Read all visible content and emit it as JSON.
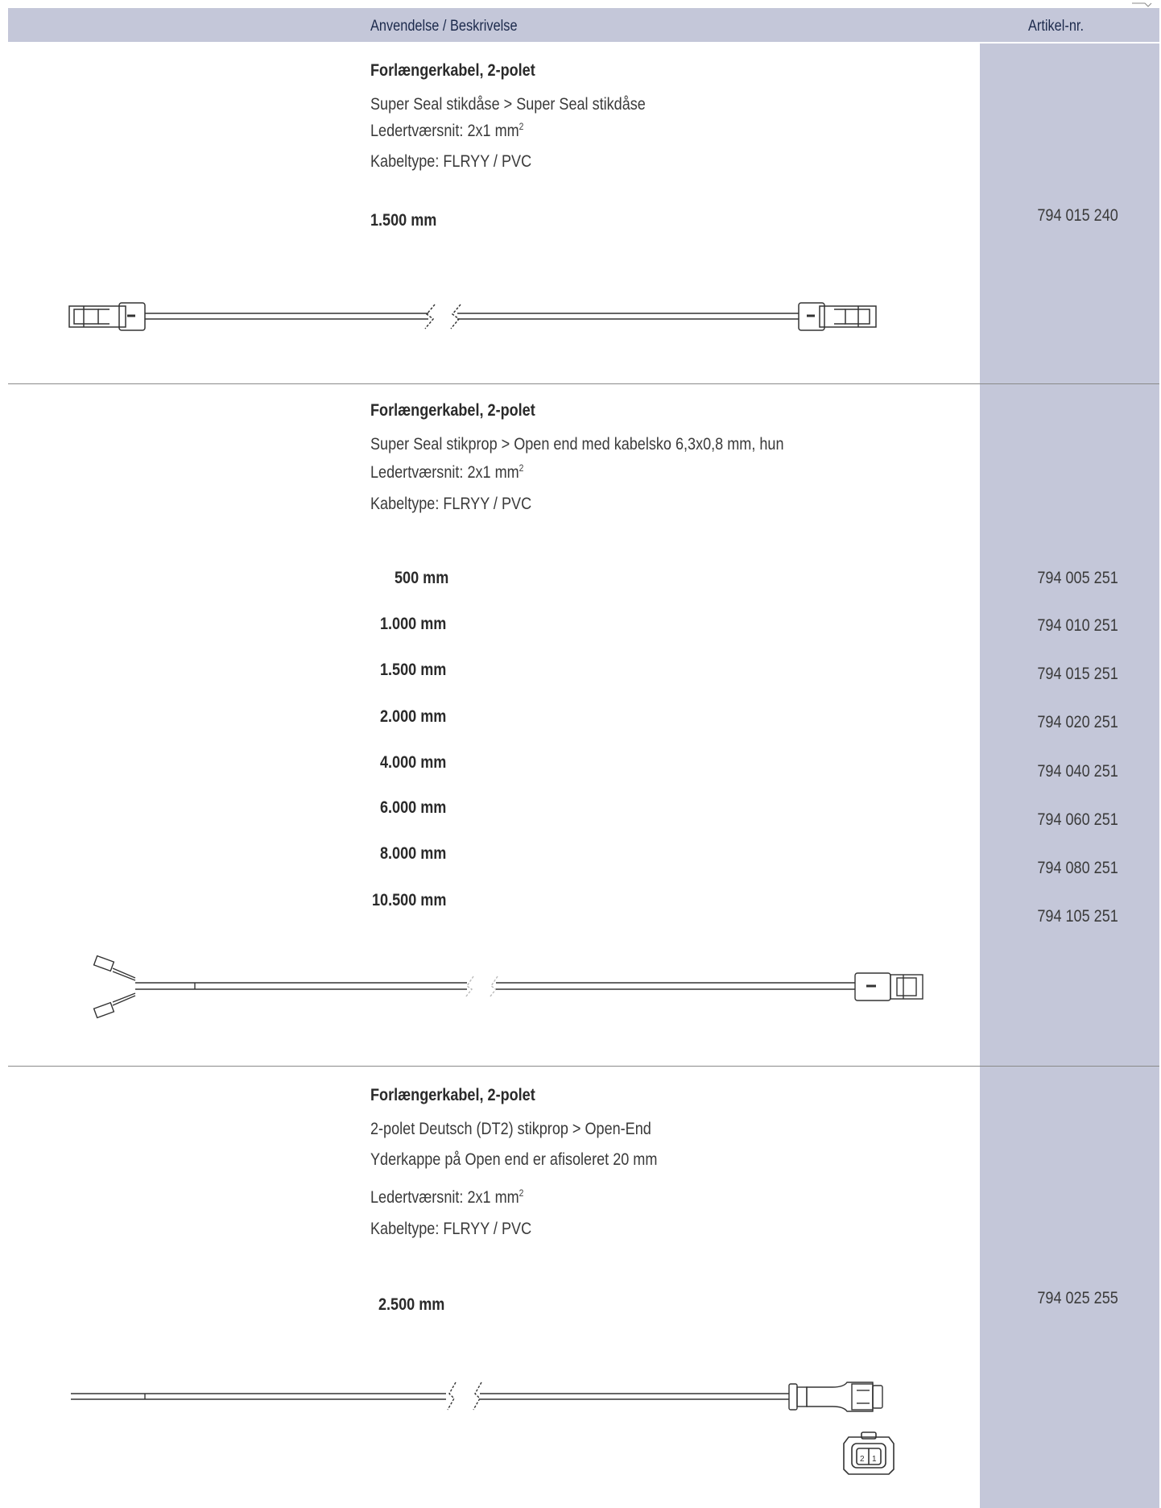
{
  "header": {
    "description_label": "Anvendelse / Beskrivelse",
    "article_label": "Artikel-nr."
  },
  "sections": [
    {
      "title": "Forlængerkabel, 2-polet",
      "lines": [
        "Super Seal stikdåse > Super Seal stikdåse",
        "Ledertværsnit: 2x1 mm",
        "Kabeltype: FLRYY / PVC"
      ],
      "superscript": "2",
      "variants": [
        {
          "length": "1.500 mm",
          "article": "794 015 240"
        }
      ]
    },
    {
      "title": "Forlængerkabel, 2-polet",
      "lines": [
        "Super Seal stikprop > Open end med kabelsko 6,3x0,8 mm, hun",
        "Ledertværsnit:   2x1 mm",
        "Kabeltype: FLRYY / PVC"
      ],
      "superscript": "2",
      "variants": [
        {
          "length": "500 mm",
          "article": "794 005 251"
        },
        {
          "length": "1.000 mm",
          "article": "794 010 251"
        },
        {
          "length": "1.500 mm",
          "article": "794 015 251"
        },
        {
          "length": "2.000 mm",
          "article": "794 020 251"
        },
        {
          "length": "4.000 mm",
          "article": "794 040 251"
        },
        {
          "length": "6.000 mm",
          "article": "794 060 251"
        },
        {
          "length": "8.000 mm",
          "article": "794 080 251"
        },
        {
          "length": "10.500 mm",
          "article": "794 105 251"
        }
      ]
    },
    {
      "title": "Forlængerkabel, 2-polet",
      "lines": [
        "2-polet Deutsch (DT2) stikprop > Open-End",
        "Yderkappe på Open end er afisoleret 20 mm",
        "Ledertværsnit:   2x1 mm",
        "Kabeltype: FLRYY / PVC"
      ],
      "superscript": "2",
      "variants": [
        {
          "length": "2.500 mm",
          "article": "794 025 255"
        }
      ],
      "pin_labels": [
        "2",
        "1"
      ]
    }
  ]
}
